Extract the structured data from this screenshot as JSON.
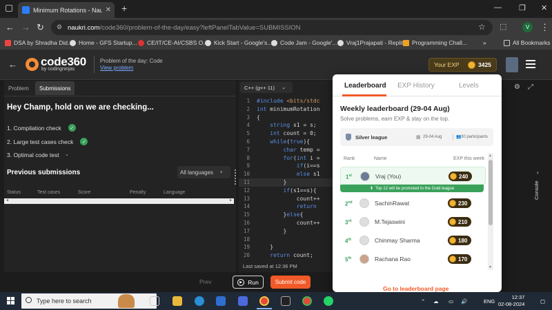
{
  "browser": {
    "tab_title": "Minimum Rotations - Naukri Co...",
    "url_domain": "naukri.com",
    "url_path": "/code360/problem-of-the-day/easy?leftPanelTabValue=SUBMISSION",
    "profile_initial": "V",
    "bookmarks": [
      "DSA by Shradha Did...",
      "Home - GFS Startup...",
      "CE/IT/CE-AI/CSBS O...",
      "Kick Start - Google's...",
      "Code Jam - Google'...",
      "Vraj1Prajapati - Replit",
      "Programming Chall..."
    ],
    "all_bookmarks": "All Bookmarks"
  },
  "header": {
    "logo_main": "code360",
    "logo_sub": "by codingninjas",
    "potd_title": "Problem of the day: Code",
    "potd_link": "View problem",
    "exp_label": "Your EXP",
    "exp_value": "3425"
  },
  "left_panel": {
    "tabs": [
      "Problem",
      "Submissions"
    ],
    "checking_heading": "Hey Champ, hold on we are checking...",
    "checks": [
      {
        "label": "1. Compilation check",
        "done": true
      },
      {
        "label": "2. Large test cases check",
        "done": true
      },
      {
        "label": "3. Optimal code test",
        "done": false
      }
    ],
    "previous_title": "Previous submissions",
    "language_filter": "All languages",
    "columns": [
      "Status",
      "Test cases",
      "Score",
      "Penalty",
      "Language"
    ]
  },
  "editor": {
    "language": "C++ (g++ 11)",
    "lines": [
      {
        "n": "1",
        "t": "#include <bits/stdc"
      },
      {
        "n": "2",
        "t": "int minimumRotation"
      },
      {
        "n": "3",
        "t": "{"
      },
      {
        "n": "4",
        "t": "    string s1 = s;"
      },
      {
        "n": "5",
        "t": "    int count = 0;"
      },
      {
        "n": "6",
        "t": "    while(true){"
      },
      {
        "n": "7",
        "t": "        char temp ="
      },
      {
        "n": "8",
        "t": "        for(int i ="
      },
      {
        "n": "9",
        "t": "            if(i==s"
      },
      {
        "n": "10",
        "t": "            else s1"
      },
      {
        "n": "11",
        "t": "        }"
      },
      {
        "n": "12",
        "t": "        if(s1==s){"
      },
      {
        "n": "13",
        "t": "            count++"
      },
      {
        "n": "14",
        "t": "            return"
      },
      {
        "n": "15",
        "t": "        }else{"
      },
      {
        "n": "16",
        "t": "            count++"
      },
      {
        "n": "17",
        "t": "        }"
      },
      {
        "n": "18",
        "t": ""
      },
      {
        "n": "19",
        "t": "    }"
      },
      {
        "n": "20",
        "t": "    return count;"
      }
    ],
    "last_saved": "Last saved at 12:36 PM"
  },
  "bottom": {
    "prev": "Prev",
    "run": "Run",
    "submit": "Submit code"
  },
  "console_label": "Console",
  "leaderboard": {
    "tabs": [
      "Leaderboard",
      "EXP History",
      "Levels"
    ],
    "title": "Weekly leaderboard (29-04 Aug)",
    "subtitle": "Solve problems, earn EXP & stay on the top.",
    "league": "Silver league",
    "league_dates": "29-04 Aug",
    "participants": "30 participants",
    "col_rank": "Rank",
    "col_name": "Name",
    "col_exp": "EXP this week",
    "promo": "Top 12 will be promoted to the Gold league",
    "rows": [
      {
        "rank": "1",
        "sup": "st",
        "name": "Vraj (You)",
        "exp": "240"
      },
      {
        "rank": "2",
        "sup": "nd",
        "name": "SachinRawat",
        "exp": "230"
      },
      {
        "rank": "3",
        "sup": "rd",
        "name": "M.Tejaswini",
        "exp": "210"
      },
      {
        "rank": "4",
        "sup": "th",
        "name": "Chinmay Sharma",
        "exp": "180"
      },
      {
        "rank": "5",
        "sup": "th",
        "name": "Rachana Rao",
        "exp": "170"
      }
    ],
    "goto": "Go to leaderboard page"
  },
  "taskbar": {
    "search_placeholder": "Type here to search",
    "lang": "ENG",
    "time": "12:37",
    "date": "02-08-2024"
  },
  "colors": {
    "accent": "#f05a28",
    "success": "#3aa15b",
    "link": "#79a9ff"
  }
}
